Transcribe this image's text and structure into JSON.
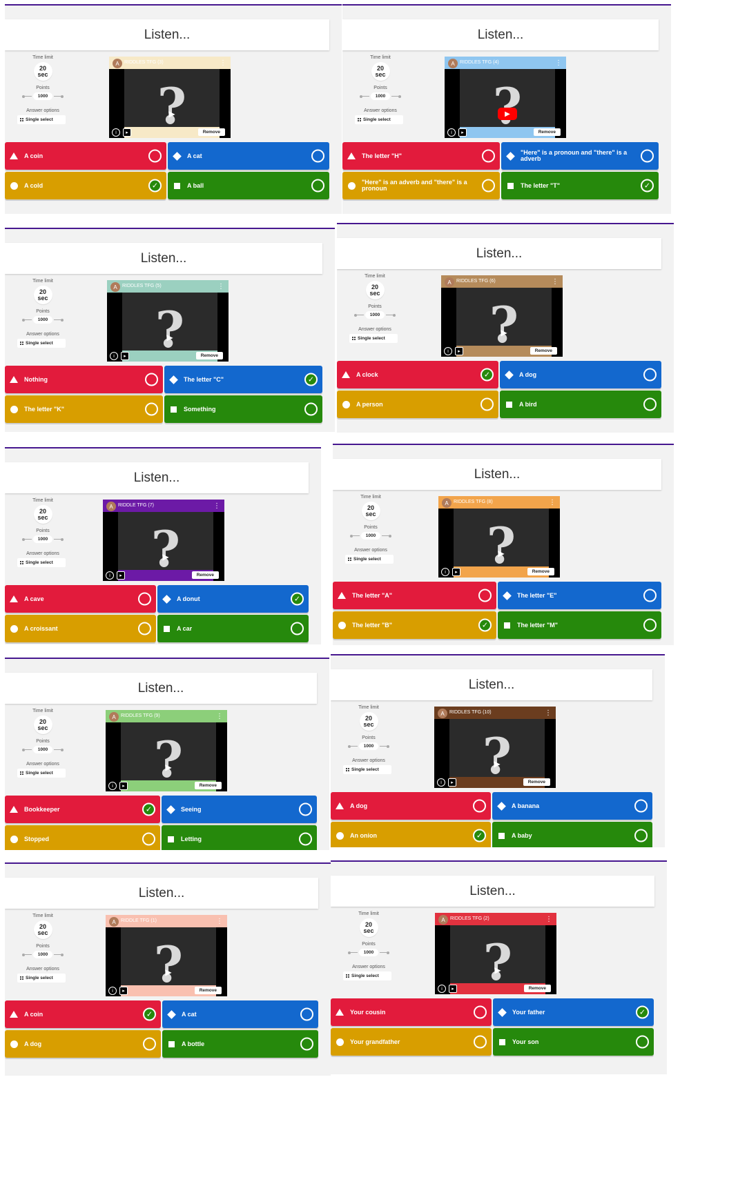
{
  "common": {
    "question_title": "Listen...",
    "time_limit_label": "Time limit",
    "time_value": "20",
    "time_unit": "sec",
    "points_label": "Points",
    "points_value": "1000",
    "answer_options_label": "Answer options",
    "answer_mode": "Single select",
    "remove_label": "Remove",
    "avatar_letter": "A"
  },
  "colors": {
    "red": "#e21b3c",
    "blue": "#1368ce",
    "yellow": "#d89e00",
    "green": "#26890c",
    "accent": "#46178f"
  },
  "cards": [
    {
      "video_title": "RIDDLES TFG (3)",
      "answers": [
        {
          "text": "A coin",
          "correct": false
        },
        {
          "text": "A cat",
          "correct": false
        },
        {
          "text": "A cold",
          "correct": true
        },
        {
          "text": "A ball",
          "correct": false
        }
      ]
    },
    {
      "video_title": "RIDDLES TFG (4)",
      "answers": [
        {
          "text": "The letter \"H\"",
          "correct": false
        },
        {
          "text": "\"Here\" is  a pronoun and \"there\" is a adverb",
          "correct": false
        },
        {
          "text": "\"Here\" is  an adverb and \"there\" is a pronoun",
          "correct": false
        },
        {
          "text": "The letter \"T\"",
          "correct": true
        }
      ]
    },
    {
      "video_title": "RIDDLES TFG (5)",
      "answers": [
        {
          "text": "Nothing",
          "correct": false
        },
        {
          "text": "The letter \"C\"",
          "correct": true
        },
        {
          "text": "The letter \"K\"",
          "correct": false
        },
        {
          "text": "Something",
          "correct": false
        }
      ]
    },
    {
      "video_title": "RIDDLES TFG (6)",
      "answers": [
        {
          "text": "A clock",
          "correct": true
        },
        {
          "text": "A dog",
          "correct": false
        },
        {
          "text": "A person",
          "correct": false
        },
        {
          "text": "A bird",
          "correct": false
        }
      ]
    },
    {
      "video_title": "RIDDLE TFG (7)",
      "answers": [
        {
          "text": "A cave",
          "correct": false
        },
        {
          "text": "A donut",
          "correct": true
        },
        {
          "text": "A croissant",
          "correct": false
        },
        {
          "text": "A car",
          "correct": false
        }
      ]
    },
    {
      "video_title": "RIDDLES TFG (8)",
      "answers": [
        {
          "text": "The letter \"A\"",
          "correct": false
        },
        {
          "text": "The letter \"E\"",
          "correct": false
        },
        {
          "text": "The letter \"B\"",
          "correct": true
        },
        {
          "text": "The letter \"M\"",
          "correct": false
        }
      ]
    },
    {
      "video_title": "RIDDLES TFG (9)",
      "answers": [
        {
          "text": "Bookkeeper",
          "correct": true
        },
        {
          "text": "Seeing",
          "correct": false
        },
        {
          "text": "Stopped",
          "correct": false
        },
        {
          "text": "Letting",
          "correct": false
        }
      ]
    },
    {
      "video_title": "RIDDLES TFG (10)",
      "answers": [
        {
          "text": "A dog",
          "correct": false
        },
        {
          "text": "A banana",
          "correct": false
        },
        {
          "text": "An onion",
          "correct": true
        },
        {
          "text": "A baby",
          "correct": false
        }
      ]
    },
    {
      "video_title": "RIDDLE TFG (1)",
      "answers": [
        {
          "text": "A coin",
          "correct": true
        },
        {
          "text": "A cat",
          "correct": false
        },
        {
          "text": "A dog",
          "correct": false
        },
        {
          "text": "A bottle",
          "correct": false
        }
      ]
    },
    {
      "video_title": "RIDDLES TFG (2)",
      "answers": [
        {
          "text": "Your cousin",
          "correct": false
        },
        {
          "text": "Your father",
          "correct": true
        },
        {
          "text": "Your grandfather",
          "correct": false
        },
        {
          "text": "Your son",
          "correct": false
        }
      ]
    }
  ]
}
